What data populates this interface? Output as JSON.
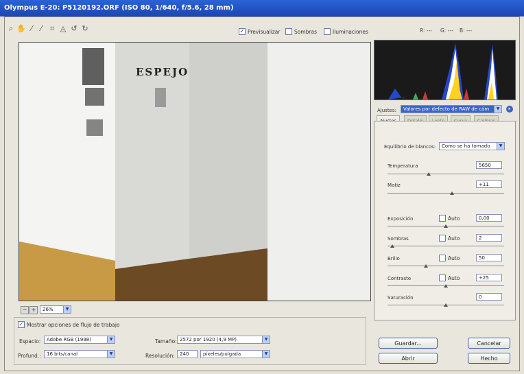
{
  "window": {
    "title": "Olympus E-20: P5120192.ORF  (ISO 80, 1/640, f/5.6, 28 mm)"
  },
  "toolbar": {
    "tools": [
      "zoom-icon",
      "hand-icon",
      "white-balance-icon",
      "color-sampler-icon",
      "crop-icon",
      "straighten-icon",
      "rotate-left-icon",
      "rotate-right-icon"
    ],
    "preview": {
      "label": "Previsualizar",
      "checked": true
    },
    "shadows": {
      "label": "Sombras",
      "checked": false
    },
    "highlights": {
      "label": "Iluminaciones",
      "checked": false
    }
  },
  "rgb_readout": {
    "r": "R: ---",
    "g": "G: ---",
    "b": "B: ---"
  },
  "image_text": "ESPEJO",
  "zoom": {
    "value": "26%"
  },
  "settings": {
    "label": "Ajustes:",
    "value": "Valores por defecto de RAW de cám"
  },
  "tabs": [
    "Ajustes",
    "Detalle",
    "Lente",
    "Curva",
    "Calibrar"
  ],
  "adjust": {
    "white_balance": {
      "label": "Equilibrio de blancos:",
      "value": "Como se ha tomado"
    },
    "temperature": {
      "label": "Temperatura",
      "value": "5650",
      "level": 0.35
    },
    "tint": {
      "label": "Matiz",
      "value": "+11",
      "level": 0.55
    },
    "exposure": {
      "label": "Exposición",
      "auto": "Auto",
      "value": "0,00",
      "level": 0.5
    },
    "shadows": {
      "label": "Sombras",
      "auto": "Auto",
      "value": "2",
      "level": 0.04
    },
    "brightness": {
      "label": "Brillo",
      "auto": "Auto",
      "value": "50",
      "level": 0.33
    },
    "contrast": {
      "label": "Contraste",
      "auto": "Auto",
      "value": "+25",
      "level": 0.5
    },
    "saturation": {
      "label": "Saturación",
      "value": "0",
      "level": 0.5
    }
  },
  "workflow": {
    "show_label": "Mostrar opciones de flujo de trabajo",
    "space": {
      "label": "Espacio:",
      "value": "Adobe RGB (1998)"
    },
    "depth": {
      "label": "Profund.:",
      "value": "16 bits/canal"
    },
    "size": {
      "label": "Tamaño:",
      "value": "2572 por 1920 (4,9 MP)"
    },
    "resolution": {
      "label": "Resolución:",
      "value": "240",
      "unit": "píxeles/pulgada"
    }
  },
  "buttons": {
    "save": "Guardar...",
    "cancel": "Cancelar",
    "open": "Abrir",
    "done": "Hecho"
  }
}
